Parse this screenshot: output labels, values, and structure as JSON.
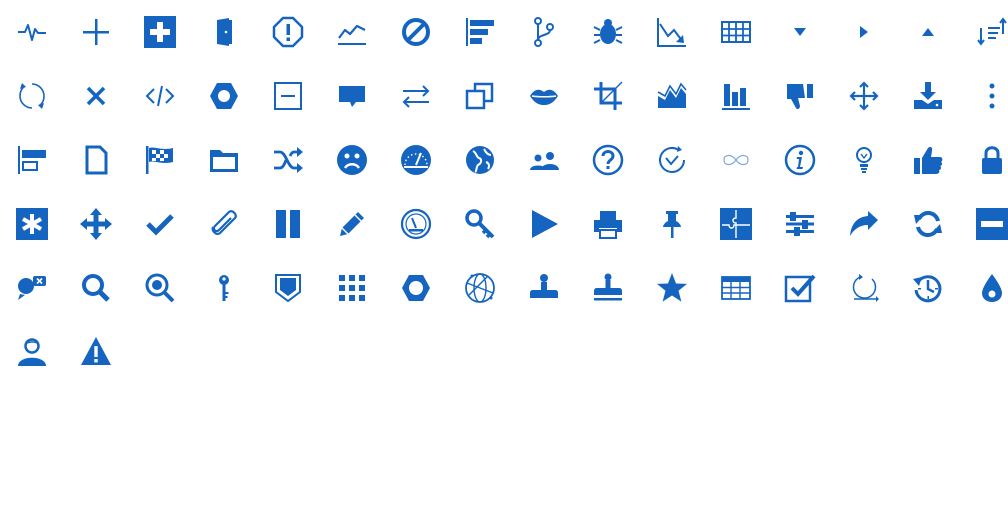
{
  "palette": {
    "icon_color": "#1565c0",
    "background": "#ffffff"
  },
  "icons": [
    "pulse-icon",
    "plus-icon",
    "plus-square-icon",
    "door-icon",
    "exclamation-octagon-icon",
    "line-chart-icon",
    "ban-icon",
    "align-left-bars-icon",
    "branch-icon",
    "bug-icon",
    "chart-down-icon",
    "grid-table-icon",
    "caret-down-icon",
    "caret-right-icon",
    "caret-up-icon",
    "sort-icon",
    "refresh-circle-icon",
    "close-icon",
    "code-icon",
    "hexagon-gear-icon",
    "minus-square-icon",
    "comment-icon",
    "exchange-icon",
    "clone-icon",
    "lips-icon",
    "crop-icon",
    "area-chart-icon",
    "bar-chart-icon",
    "thumbs-down-icon",
    "move-arrows-icon",
    "download-tray-icon",
    "more-vertical-icon",
    "align-left-frame-icon",
    "file-icon",
    "checkered-flag-icon",
    "folder-open-icon",
    "shuffle-icon",
    "sad-face-icon",
    "speedometer-icon",
    "globe-icon",
    "users-icon",
    "question-circle-icon",
    "check-circle-icon",
    "infinity-icon",
    "info-circle-icon",
    "lightbulb-icon",
    "thumbs-up-icon",
    "lock-icon",
    "asterisk-square-icon",
    "move-icon",
    "checkmark-icon",
    "paperclip-icon",
    "pause-icon",
    "pencil-icon",
    "gauge-icon",
    "key-icon",
    "play-icon",
    "print-icon",
    "pushpin-icon",
    "puzzle-icon",
    "sliders-icon",
    "share-icon",
    "sync-icon",
    "minus-box-icon",
    "chat-close-icon",
    "search-icon",
    "search-focus-icon",
    "key-vertical-icon",
    "badge-icon",
    "grid-icon",
    "hexagon-icon",
    "globe-network-icon",
    "stamp-icon",
    "stamp-underline-icon",
    "star-icon",
    "table-icon",
    "checkbox-icon",
    "circle-arrow-icon",
    "history-icon",
    "drop-icon",
    "user-icon",
    "warning-icon"
  ]
}
